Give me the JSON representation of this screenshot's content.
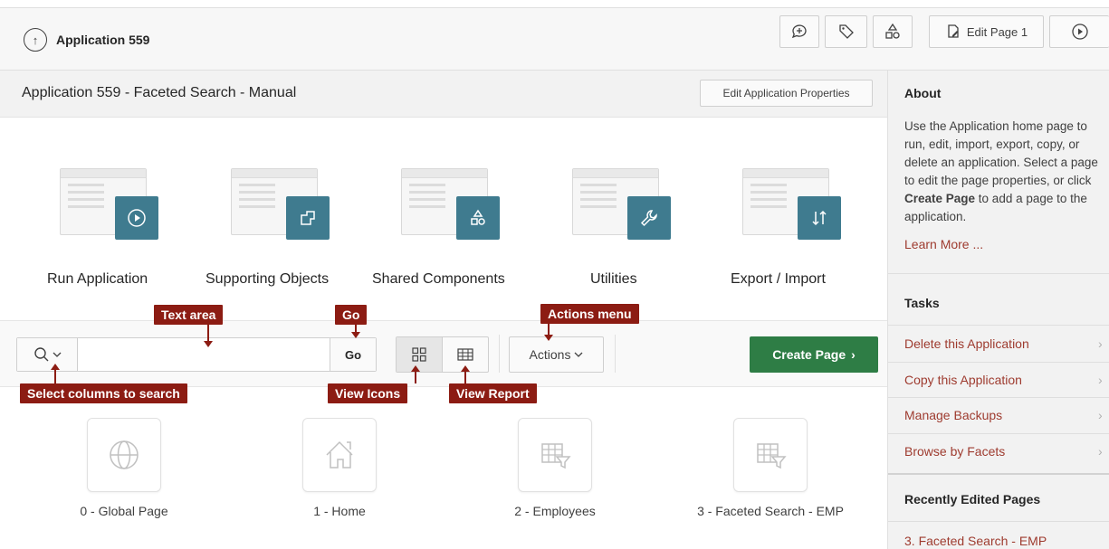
{
  "header": {
    "app_title": "Application 559",
    "edit_page_label": "Edit Page 1",
    "icons": [
      "up-arrow-circle-icon",
      "add-comment-icon",
      "tag-icon",
      "shared-components-icon",
      "edit-page-icon",
      "run-page-icon"
    ]
  },
  "main": {
    "page_title": "Application 559 - Faceted Search - Manual",
    "edit_properties_label": "Edit Application Properties"
  },
  "hero_items": [
    {
      "label": "Run Application",
      "icon": "play-circle-icon"
    },
    {
      "label": "Supporting Objects",
      "icon": "supporting-objects-icon"
    },
    {
      "label": "Shared Components",
      "icon": "shapes-icon"
    },
    {
      "label": "Utilities",
      "icon": "wrench-icon"
    },
    {
      "label": "Export / Import",
      "icon": "up-down-arrows-icon"
    }
  ],
  "toolbar": {
    "search_placeholder": "",
    "go_label": "Go",
    "actions_label": "Actions",
    "create_page_label": "Create Page"
  },
  "callouts": {
    "text_area": "Text area",
    "go": "Go",
    "actions_menu": "Actions menu",
    "select_columns": "Select columns to search",
    "view_icons": "View Icons",
    "view_report": "View Report"
  },
  "pages": [
    {
      "label": "0 - Global Page",
      "icon": "globe-icon"
    },
    {
      "label": "1 - Home",
      "icon": "home-icon"
    },
    {
      "label": "2 - Employees",
      "icon": "faceted-table-icon"
    },
    {
      "label": "3 - Faceted Search - EMP",
      "icon": "faceted-table-icon"
    }
  ],
  "sidebar": {
    "about_title": "About",
    "about_text_1": "Use the Application home page to run, edit, import, export, copy, or delete an application. Select a page to edit the page properties, or click ",
    "about_text_bold": "Create Page",
    "about_text_2": " to add a page to the application.",
    "learn_more": "Learn More ...",
    "tasks_title": "Tasks",
    "tasks": [
      {
        "label": "Delete this Application"
      },
      {
        "label": "Copy this Application"
      },
      {
        "label": "Manage Backups"
      },
      {
        "label": "Browse by Facets"
      }
    ],
    "recent_title": "Recently Edited Pages",
    "recent_pages": [
      "3. Faceted Search - EMP"
    ]
  },
  "colors": {
    "accent_teal": "#3f7b8f",
    "create_green": "#2e7d45",
    "callout_red": "#8c1c13",
    "link_red": "#9e3b2f"
  }
}
